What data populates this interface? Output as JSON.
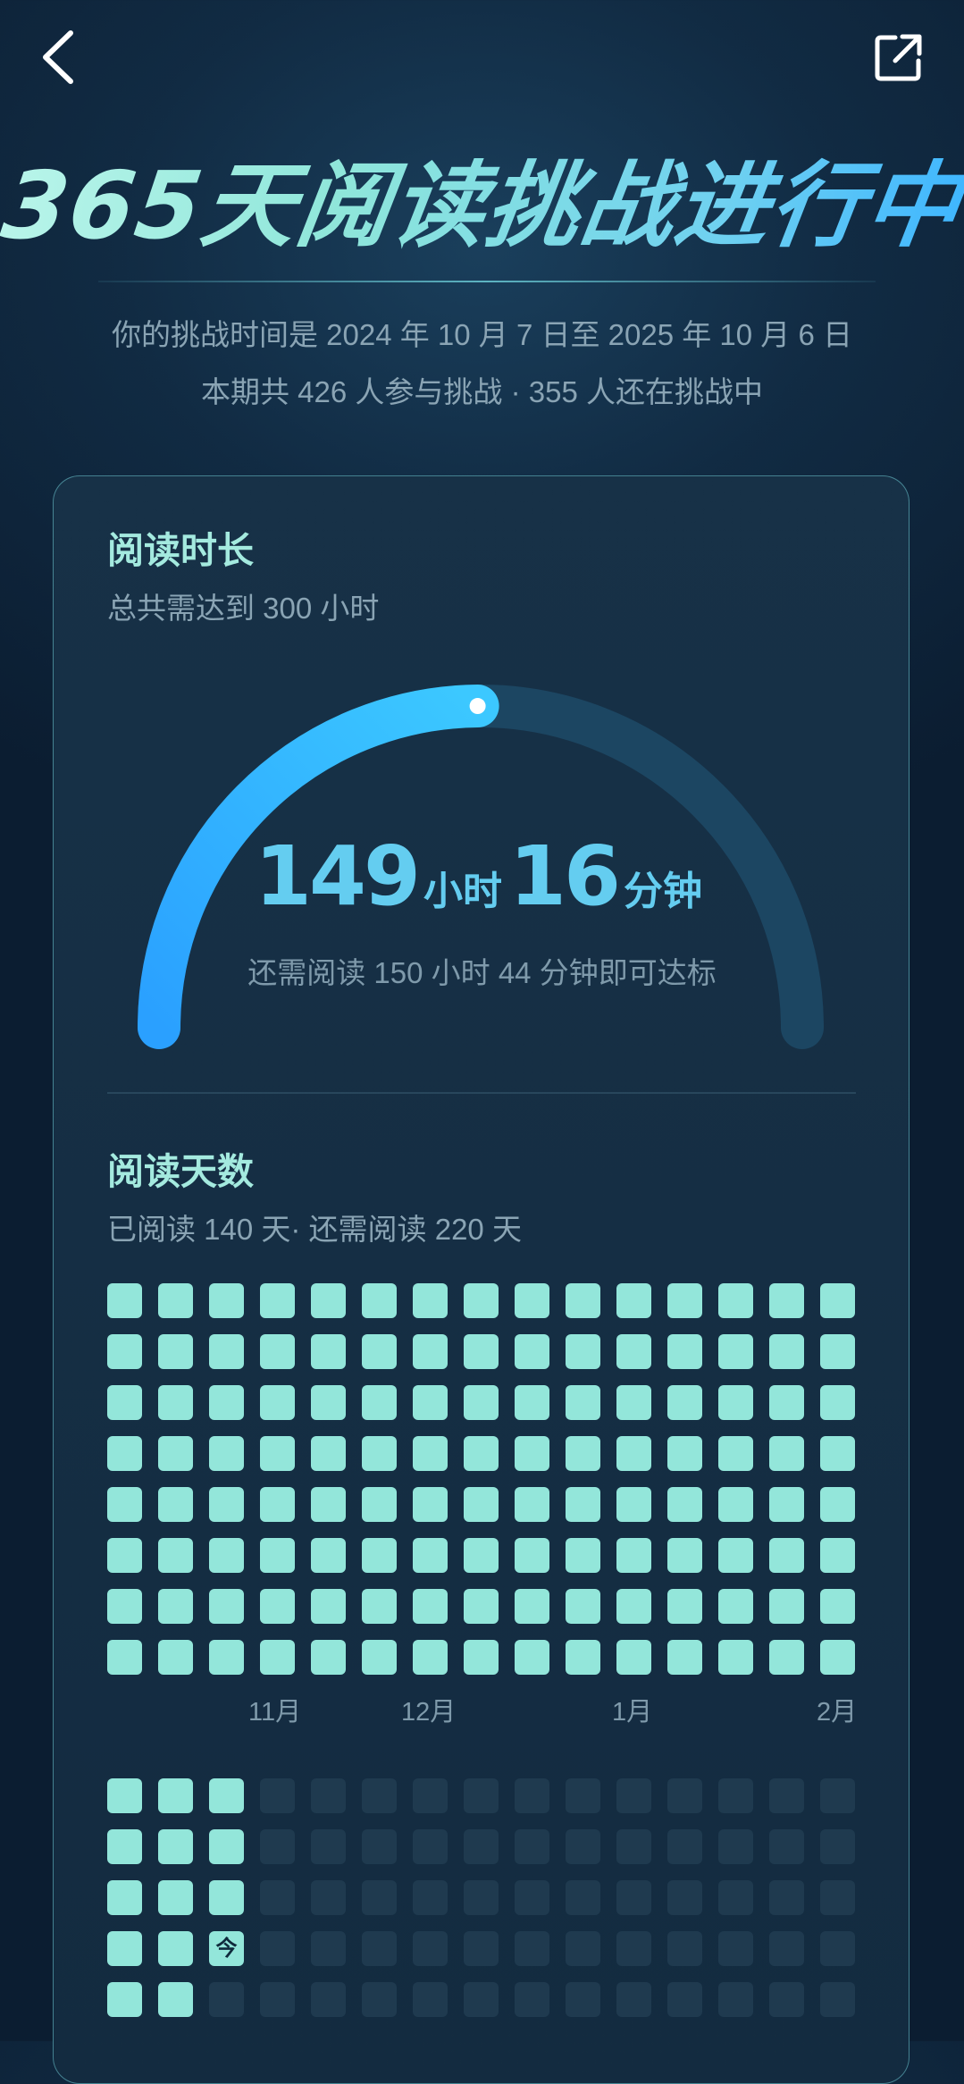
{
  "header": {
    "title": "365天阅读挑战进行中",
    "date_range": "你的挑战时间是 2024 年 10 月 7 日至 2025 年 10 月 6 日",
    "participants": "本期共 426 人参与挑战 · 355 人还在挑战中"
  },
  "reading_time": {
    "title": "阅读时长",
    "goal": "总共需达到 300 小时",
    "hours": "149",
    "hours_unit": "小时",
    "minutes": "16",
    "minutes_unit": "分钟",
    "remaining": "还需阅读 150 小时 44 分钟即可达标",
    "progress_fraction": 0.497
  },
  "reading_days": {
    "title": "阅读天数",
    "summary": "已阅读 140 天· 还需阅读 220 天",
    "today_label": "今",
    "months": [
      "11月",
      "12月",
      "1月",
      "2月"
    ]
  },
  "colors": {
    "accent": "#93e6da",
    "gauge_fill": "#35b4ff",
    "gauge_track": "#1c4662",
    "empty_cell": "#1f3a4f"
  }
}
